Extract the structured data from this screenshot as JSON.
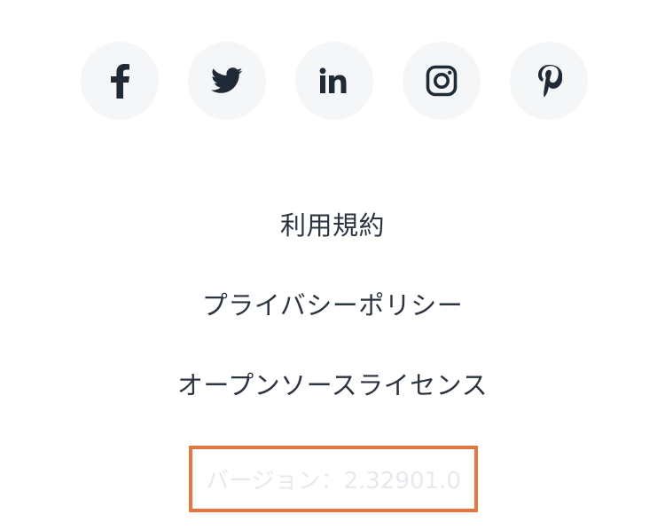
{
  "social": {
    "items": [
      {
        "icon": "facebook-icon",
        "label": "f"
      },
      {
        "icon": "twitter-icon"
      },
      {
        "icon": "linkedin-icon",
        "label": "in"
      },
      {
        "icon": "instagram-icon"
      },
      {
        "icon": "pinterest-icon"
      }
    ]
  },
  "links": {
    "terms": "利用規約",
    "privacy": "プライバシーポリシー",
    "oss": "オープンソースライセンス"
  },
  "version": {
    "text": "バージョン：2.32901.0"
  },
  "colors": {
    "icon_background": "#f4f6f8",
    "icon_color": "#1f2a36",
    "link_text": "#2b3440",
    "version_text": "#e6e9ed",
    "highlight_border": "#e8743f"
  }
}
